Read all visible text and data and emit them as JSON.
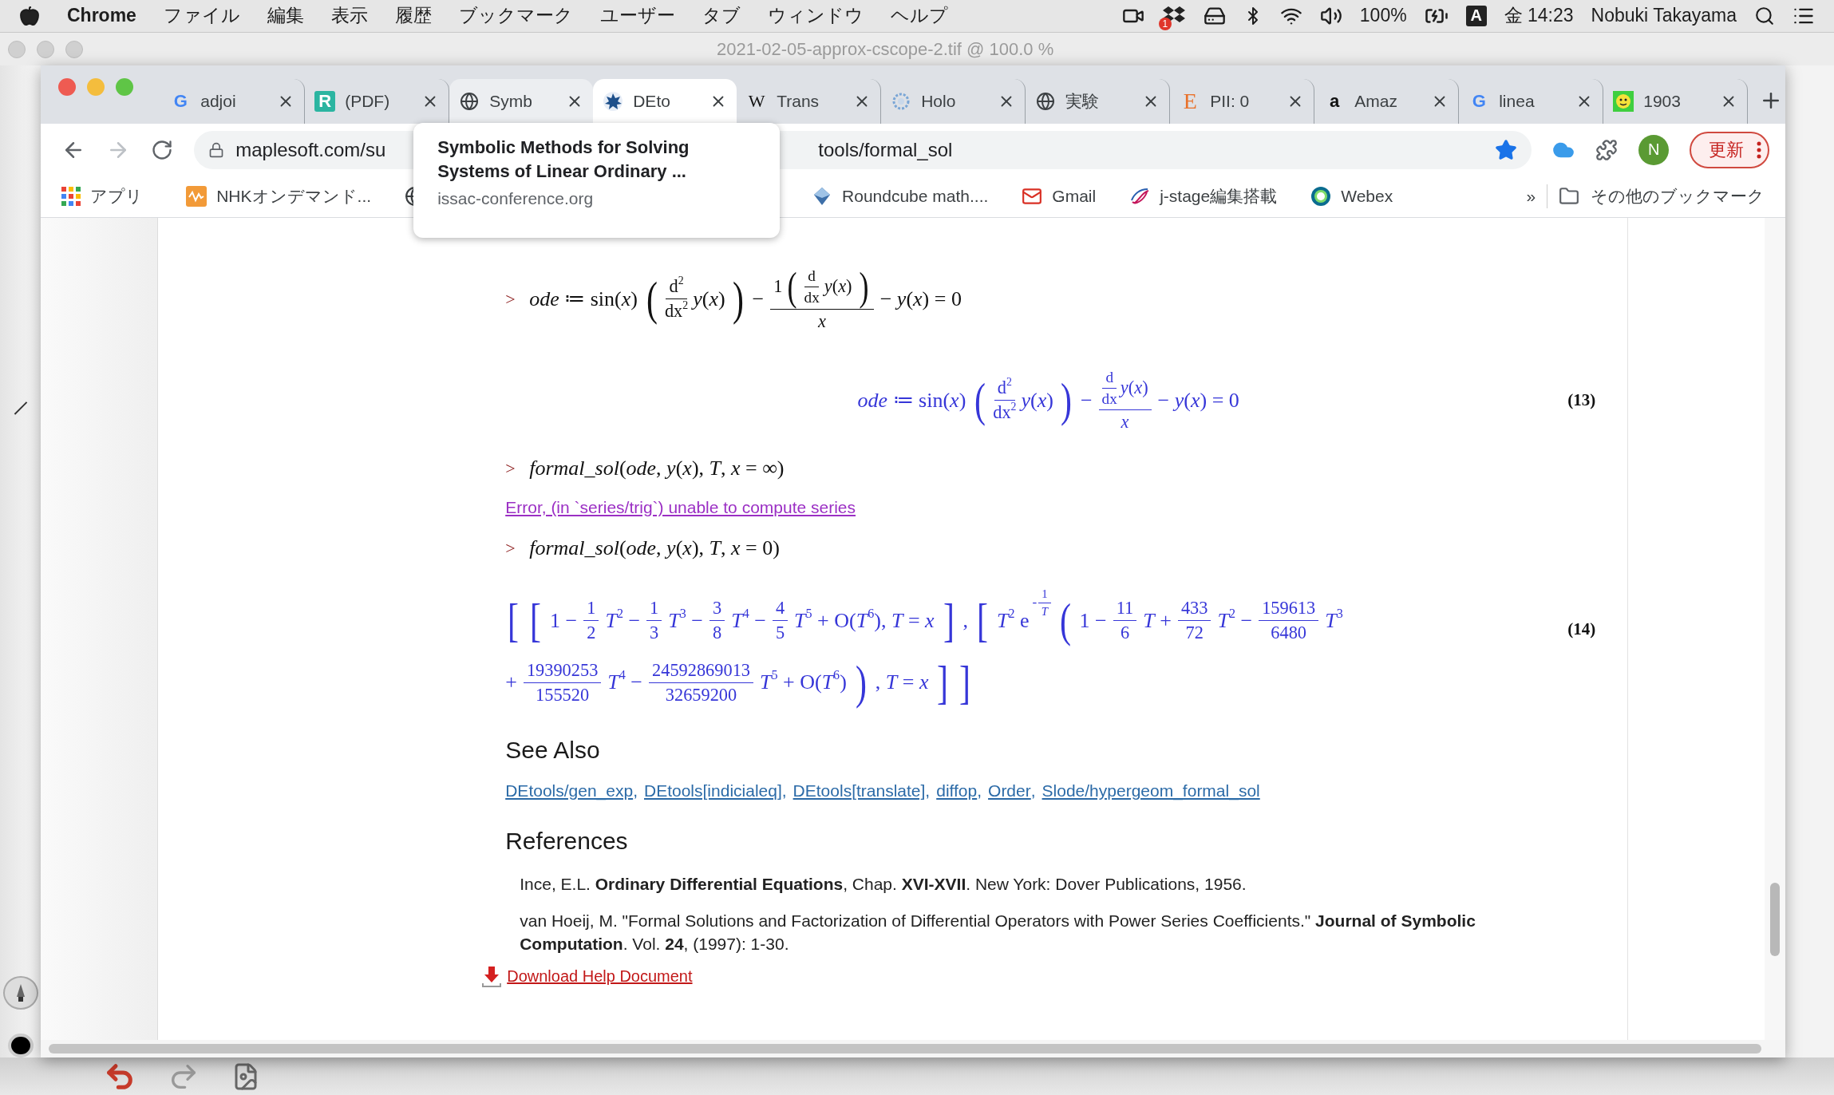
{
  "menu_bar": {
    "app": "Chrome",
    "menus": [
      "ファイル",
      "編集",
      "表示",
      "履歴",
      "ブックマーク",
      "ユーザー",
      "タブ",
      "ウィンドウ",
      "ヘルプ"
    ],
    "dropbox_badge": "1",
    "battery": "100%",
    "input_source": "A",
    "clock": "金 14:23",
    "user": "Nobuki Takayama"
  },
  "background_window": {
    "title": "2021-02-05-approx-cscope-2.tif @ 100.0 %"
  },
  "browser": {
    "tabs": [
      {
        "title": "adjoi",
        "favicon_text": "G",
        "selected": false,
        "hovered": false
      },
      {
        "title": "(PDF)",
        "favicon_text": "R",
        "selected": false,
        "hovered": false
      },
      {
        "title": "Symb",
        "selected": false,
        "hovered": true
      },
      {
        "title": "DEto",
        "selected": true,
        "hovered": false
      },
      {
        "title": "Trans",
        "favicon_text": "W",
        "selected": false,
        "hovered": false
      },
      {
        "title": "Holo",
        "selected": false,
        "hovered": false
      },
      {
        "title": "実験",
        "selected": false,
        "hovered": false
      },
      {
        "title": "PII: 0",
        "favicon_text": "E",
        "selected": false,
        "hovered": false
      },
      {
        "title": "Amaz",
        "favicon_text": "a",
        "selected": false,
        "hovered": false
      },
      {
        "title": "linea",
        "favicon_text": "G",
        "selected": false,
        "hovered": false
      },
      {
        "title": "1903",
        "selected": false,
        "hovered": false
      }
    ],
    "address": {
      "value_start": "maplesoft.com/su",
      "value_end": "tools/formal_sol"
    },
    "profile": "N",
    "update_button": "更新",
    "bookmarks": [
      {
        "label": "アプリ"
      },
      {
        "label": "NHKオンデマンド..."
      },
      {
        "label": "Roundcube math...."
      },
      {
        "label": "Gmail"
      },
      {
        "label": "j-stage編集搭載"
      },
      {
        "label": "Webex"
      }
    ],
    "bookmarks_overflow": "»",
    "other_bookmarks": "その他のブックマーク",
    "tooltip": {
      "title_lines": [
        "Symbolic Methods for Solving",
        "Systems of Linear Ordinary ..."
      ],
      "url": "issac-conference.org"
    }
  },
  "page": {
    "worksheet": [
      {
        "kind": "input",
        "prompt": ">",
        "lines": [
          [
            {
              "kind": "t",
              "text": "*ode* ≔ sin(*x*)"
            },
            {
              "kind": "g",
              "open": "(",
              "close": ")",
              "body": [
                {
                  "kind": "f",
                  "num": [
                    {
                      "kind": "t",
                      "text": "d$^{2}$"
                    }
                  ],
                  "den": [
                    {
                      "kind": "t",
                      "text": "dx$^{2}$"
                    }
                  ]
                },
                {
                  "kind": "t",
                  "text": "*y*(*x*)"
                }
              ]
            },
            {
              "kind": "t",
              "text": "−"
            },
            {
              "kind": "f",
              "num": [
                {
                  "kind": "t",
                  "text": "1"
                },
                {
                  "kind": "g",
                  "open": "(",
                  "close": ")",
                  "body": [
                    {
                      "kind": "f",
                      "num": [
                        {
                          "kind": "t",
                          "text": "d"
                        }
                      ],
                      "den": [
                        {
                          "kind": "t",
                          "text": "dx"
                        }
                      ]
                    },
                    {
                      "kind": "t",
                      "text": "*y*(*x*)"
                    }
                  ]
                }
              ],
              "den": [
                {
                  "kind": "t",
                  "text": "*x*"
                }
              ]
            },
            {
              "kind": "t",
              "text": "− *y*(*x*) = 0"
            }
          ]
        ]
      },
      {
        "kind": "output",
        "label": "(13)",
        "lines": [
          [
            {
              "kind": "t",
              "text": "*ode* ≔ sin(*x*)"
            },
            {
              "kind": "g",
              "open": "(",
              "close": ")",
              "body": [
                {
                  "kind": "f",
                  "num": [
                    {
                      "kind": "t",
                      "text": "d$^{2}$"
                    }
                  ],
                  "den": [
                    {
                      "kind": "t",
                      "text": "dx$^{2}$"
                    }
                  ]
                },
                {
                  "kind": "t",
                  "text": "*y*(*x*)"
                }
              ]
            },
            {
              "kind": "t",
              "text": "−"
            },
            {
              "kind": "f",
              "num": [
                {
                  "kind": "f",
                  "num": [
                    {
                      "kind": "t",
                      "text": "d"
                    }
                  ],
                  "den": [
                    {
                      "kind": "t",
                      "text": "dx"
                    }
                  ]
                },
                {
                  "kind": "t",
                  "text": "*y*(*x*)"
                }
              ],
              "den": [
                {
                  "kind": "t",
                  "text": "*x*"
                }
              ]
            },
            {
              "kind": "t",
              "text": "− *y*(*x*) = 0"
            }
          ]
        ]
      },
      {
        "kind": "input",
        "prompt": ">",
        "lines": [
          [
            {
              "kind": "t",
              "text": "*formal_sol*(*ode*, *y*(*x*), *T*, *x* = ∞)"
            }
          ]
        ]
      },
      {
        "kind": "error",
        "text": "Error, (in `series/trig`) unable to compute series"
      },
      {
        "kind": "input",
        "prompt": ">",
        "lines": [
          [
            {
              "kind": "t",
              "text": "*formal_sol*(*ode*, *y*(*x*), *T*, *x* = 0)"
            }
          ]
        ]
      },
      {
        "kind": "output",
        "label": "(14)",
        "lines": [
          [
            {
              "kind": "big",
              "text": "["
            },
            {
              "kind": "big",
              "text": "["
            },
            {
              "kind": "t",
              "text": "1 −"
            },
            {
              "kind": "f",
              "num": [
                {
                  "kind": "t",
                  "text": "1"
                }
              ],
              "den": [
                {
                  "kind": "t",
                  "text": "2"
                }
              ]
            },
            {
              "kind": "t",
              "text": "*T*$^{2}$ −"
            },
            {
              "kind": "f",
              "num": [
                {
                  "kind": "t",
                  "text": "1"
                }
              ],
              "den": [
                {
                  "kind": "t",
                  "text": "3"
                }
              ]
            },
            {
              "kind": "t",
              "text": "*T*$^{3}$ −"
            },
            {
              "kind": "f",
              "num": [
                {
                  "kind": "t",
                  "text": "3"
                }
              ],
              "den": [
                {
                  "kind": "t",
                  "text": "8"
                }
              ]
            },
            {
              "kind": "t",
              "text": "*T*$^{4}$ −"
            },
            {
              "kind": "f",
              "num": [
                {
                  "kind": "t",
                  "text": "4"
                }
              ],
              "den": [
                {
                  "kind": "t",
                  "text": "5"
                }
              ]
            },
            {
              "kind": "t",
              "text": "*T*$^{5}$ + O(*T*$^{6}$), *T* = *x*"
            },
            {
              "kind": "big",
              "text": "]"
            },
            {
              "kind": "t",
              "text": ","
            },
            {
              "kind": "big",
              "text": "["
            },
            {
              "kind": "t",
              "text": "*T*$^{2}$ e"
            },
            {
              "kind": "sup",
              "body": [
                {
                  "kind": "t",
                  "text": "-"
                },
                {
                  "kind": "f",
                  "num": [
                    {
                      "kind": "t",
                      "text": "1"
                    }
                  ],
                  "den": [
                    {
                      "kind": "t",
                      "text": "*T*"
                    }
                  ]
                }
              ]
            },
            {
              "kind": "big",
              "text": "("
            },
            {
              "kind": "t",
              "text": "1 −"
            },
            {
              "kind": "f",
              "num": [
                {
                  "kind": "t",
                  "text": "11"
                }
              ],
              "den": [
                {
                  "kind": "t",
                  "text": "6"
                }
              ]
            },
            {
              "kind": "t",
              "text": "*T* +"
            },
            {
              "kind": "f",
              "num": [
                {
                  "kind": "t",
                  "text": "433"
                }
              ],
              "den": [
                {
                  "kind": "t",
                  "text": "72"
                }
              ]
            },
            {
              "kind": "t",
              "text": "*T*$^{2}$ −"
            },
            {
              "kind": "f",
              "num": [
                {
                  "kind": "t",
                  "text": "159613"
                }
              ],
              "den": [
                {
                  "kind": "t",
                  "text": "6480"
                }
              ]
            },
            {
              "kind": "t",
              "text": "*T*$^{3}$"
            }
          ],
          [
            {
              "kind": "t",
              "text": "+"
            },
            {
              "kind": "f",
              "num": [
                {
                  "kind": "t",
                  "text": "19390253"
                }
              ],
              "den": [
                {
                  "kind": "t",
                  "text": "155520"
                }
              ]
            },
            {
              "kind": "t",
              "text": "*T*$^{4}$ −"
            },
            {
              "kind": "f",
              "num": [
                {
                  "kind": "t",
                  "text": "24592869013"
                }
              ],
              "den": [
                {
                  "kind": "t",
                  "text": "32659200"
                }
              ]
            },
            {
              "kind": "t",
              "text": "*T*$^{5}$ + O(*T*$^{6}$)"
            },
            {
              "kind": "big",
              "text": ")"
            },
            {
              "kind": "t",
              "text": ", *T* = *x*"
            },
            {
              "kind": "big",
              "text": "]"
            },
            {
              "kind": "big",
              "text": "]"
            }
          ]
        ]
      }
    ],
    "see_also": {
      "heading": "See Also",
      "separator": ",",
      "links": [
        "DEtools/gen_exp",
        "DEtools[indicialeq]",
        "DEtools[translate]",
        "diffop",
        "Order",
        "Slode/hypergeom_formal_sol"
      ]
    },
    "references": {
      "heading": "References",
      "items": [
        "Ince, E.L. **Ordinary Differential Equations**, Chap. **XVI-XVII**. New York: Dover Publications, 1956.",
        "van Hoeij, M. \"Formal Solutions and Factorization of Differential Operators with Power Series Coefficients.\" **Journal of Symbolic Computation**. Vol. **24**, (1997): 1-30."
      ]
    },
    "download": "Download Help Document"
  }
}
